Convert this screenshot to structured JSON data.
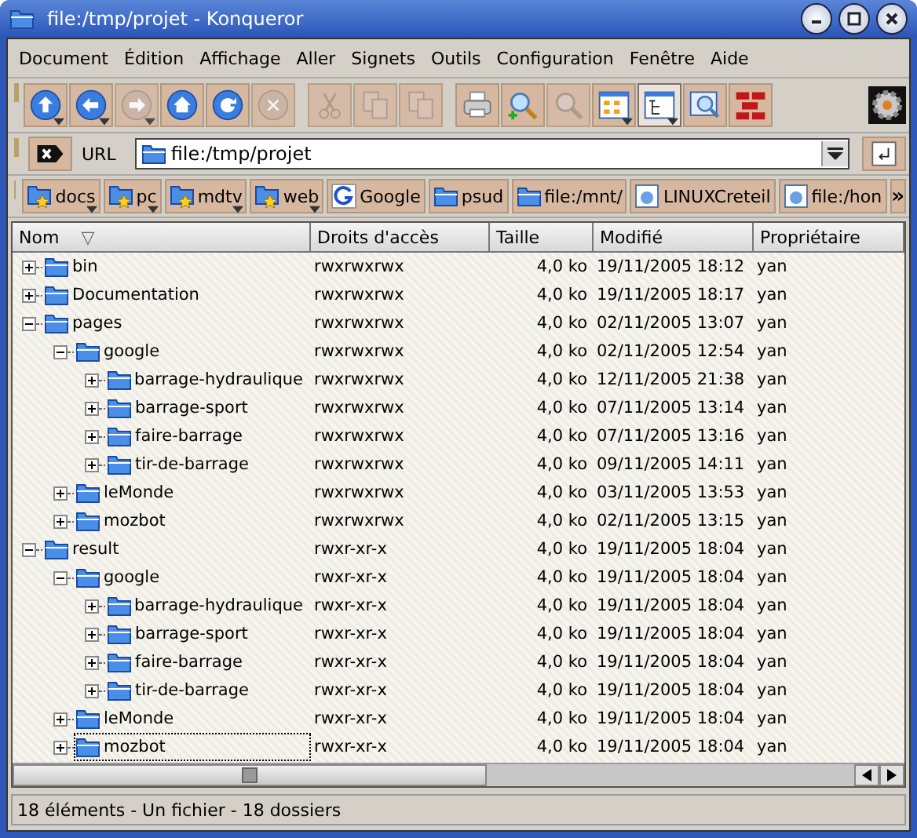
{
  "window": {
    "title": "file:/tmp/projet - Konqueror"
  },
  "menu": [
    "Document",
    "Édition",
    "Affichage",
    "Aller",
    "Signets",
    "Outils",
    "Configuration",
    "Fenêtre",
    "Aide"
  ],
  "toolbar": [
    {
      "kind": "up",
      "disabled": false,
      "dropdown": true,
      "pressed": false
    },
    {
      "kind": "back",
      "disabled": false,
      "dropdown": true,
      "pressed": false
    },
    {
      "kind": "forward",
      "disabled": true,
      "dropdown": true,
      "pressed": false
    },
    {
      "kind": "home",
      "disabled": false,
      "dropdown": false,
      "pressed": false
    },
    {
      "kind": "reload",
      "disabled": false,
      "dropdown": false,
      "pressed": false
    },
    {
      "kind": "stop",
      "disabled": true,
      "dropdown": false,
      "pressed": false
    },
    {
      "kind": "cut",
      "disabled": true,
      "dropdown": false,
      "pressed": false
    },
    {
      "kind": "copy",
      "disabled": true,
      "dropdown": false,
      "pressed": false
    },
    {
      "kind": "paste",
      "disabled": true,
      "dropdown": false,
      "pressed": false
    },
    {
      "kind": "print",
      "disabled": false,
      "dropdown": false,
      "pressed": false
    },
    {
      "kind": "zoom-in",
      "disabled": false,
      "dropdown": false,
      "pressed": false
    },
    {
      "kind": "zoom-out",
      "disabled": true,
      "dropdown": false,
      "pressed": false
    },
    {
      "kind": "icon-view",
      "disabled": false,
      "dropdown": true,
      "pressed": false
    },
    {
      "kind": "tree-view",
      "disabled": false,
      "dropdown": true,
      "pressed": true
    },
    {
      "kind": "preview",
      "disabled": false,
      "dropdown": false,
      "pressed": false
    },
    {
      "kind": "bricks",
      "disabled": false,
      "dropdown": false,
      "pressed": false
    }
  ],
  "location": {
    "label": "URL",
    "value": "file:/tmp/projet"
  },
  "bookmarks": [
    {
      "label": "docs",
      "kind": "star-folder",
      "dropdown": true
    },
    {
      "label": "pc",
      "kind": "star-folder",
      "dropdown": true
    },
    {
      "label": "mdtv",
      "kind": "star-folder",
      "dropdown": true
    },
    {
      "label": "web",
      "kind": "star-folder",
      "dropdown": true
    },
    {
      "label": "Google",
      "kind": "google",
      "dropdown": false
    },
    {
      "label": "psud",
      "kind": "folder",
      "dropdown": false
    },
    {
      "label": "file:/mnt/",
      "kind": "folder",
      "dropdown": false
    },
    {
      "label": "LINUXCreteil",
      "kind": "web",
      "dropdown": false
    },
    {
      "label": "file:/hon",
      "kind": "web",
      "dropdown": false
    }
  ],
  "bookmarks_more": "»",
  "table": {
    "columns": [
      "Nom",
      "Droits d'accès",
      "Taille",
      "Modifié",
      "Propriétaire"
    ],
    "sort_indicator": "▽",
    "rows": [
      {
        "name": "bin",
        "perms": "rwxrwxrwx",
        "size": "4,0 ko",
        "modified": "19/11/2005 18:12",
        "owner": "yan",
        "expanded": false,
        "focused": false
      },
      {
        "name": "Documentation",
        "perms": "rwxrwxrwx",
        "size": "4,0 ko",
        "modified": "19/11/2005 18:17",
        "owner": "yan",
        "expanded": false,
        "focused": false
      },
      {
        "name": "pages",
        "perms": "rwxrwxrwx",
        "size": "4,0 ko",
        "modified": "02/11/2005 13:07",
        "owner": "yan",
        "expanded": true,
        "focused": false,
        "children": [
          {
            "name": "google",
            "perms": "rwxrwxrwx",
            "size": "4,0 ko",
            "modified": "02/11/2005 12:54",
            "owner": "yan",
            "expanded": true,
            "focused": false,
            "children": [
              {
                "name": "barrage-hydraulique",
                "perms": "rwxrwxrwx",
                "size": "4,0 ko",
                "modified": "12/11/2005 21:38",
                "owner": "yan",
                "expanded": false,
                "focused": false
              },
              {
                "name": "barrage-sport",
                "perms": "rwxrwxrwx",
                "size": "4,0 ko",
                "modified": "07/11/2005 13:14",
                "owner": "yan",
                "expanded": false,
                "focused": false
              },
              {
                "name": "faire-barrage",
                "perms": "rwxrwxrwx",
                "size": "4,0 ko",
                "modified": "07/11/2005 13:16",
                "owner": "yan",
                "expanded": false,
                "focused": false
              },
              {
                "name": "tir-de-barrage",
                "perms": "rwxrwxrwx",
                "size": "4,0 ko",
                "modified": "09/11/2005 14:11",
                "owner": "yan",
                "expanded": false,
                "focused": false
              }
            ]
          },
          {
            "name": "leMonde",
            "perms": "rwxrwxrwx",
            "size": "4,0 ko",
            "modified": "03/11/2005 13:53",
            "owner": "yan",
            "expanded": false,
            "focused": false
          },
          {
            "name": "mozbot",
            "perms": "rwxrwxrwx",
            "size": "4,0 ko",
            "modified": "02/11/2005 13:15",
            "owner": "yan",
            "expanded": false,
            "focused": false
          }
        ]
      },
      {
        "name": "result",
        "perms": "rwxr-xr-x",
        "size": "4,0 ko",
        "modified": "19/11/2005 18:04",
        "owner": "yan",
        "expanded": true,
        "focused": false,
        "children": [
          {
            "name": "google",
            "perms": "rwxr-xr-x",
            "size": "4,0 ko",
            "modified": "19/11/2005 18:04",
            "owner": "yan",
            "expanded": true,
            "focused": false,
            "children": [
              {
                "name": "barrage-hydraulique",
                "perms": "rwxr-xr-x",
                "size": "4,0 ko",
                "modified": "19/11/2005 18:04",
                "owner": "yan",
                "expanded": false,
                "focused": false
              },
              {
                "name": "barrage-sport",
                "perms": "rwxr-xr-x",
                "size": "4,0 ko",
                "modified": "19/11/2005 18:04",
                "owner": "yan",
                "expanded": false,
                "focused": false
              },
              {
                "name": "faire-barrage",
                "perms": "rwxr-xr-x",
                "size": "4,0 ko",
                "modified": "19/11/2005 18:04",
                "owner": "yan",
                "expanded": false,
                "focused": false
              },
              {
                "name": "tir-de-barrage",
                "perms": "rwxr-xr-x",
                "size": "4,0 ko",
                "modified": "19/11/2005 18:04",
                "owner": "yan",
                "expanded": false,
                "focused": false
              }
            ]
          },
          {
            "name": "leMonde",
            "perms": "rwxr-xr-x",
            "size": "4,0 ko",
            "modified": "19/11/2005 18:04",
            "owner": "yan",
            "expanded": false,
            "focused": false
          },
          {
            "name": "mozbot",
            "perms": "rwxr-xr-x",
            "size": "4,0 ko",
            "modified": "19/11/2005 18:04",
            "owner": "yan",
            "expanded": false,
            "focused": true
          }
        ]
      }
    ]
  },
  "status_bar": "18 éléments - Un fichier - 18 dossiers"
}
